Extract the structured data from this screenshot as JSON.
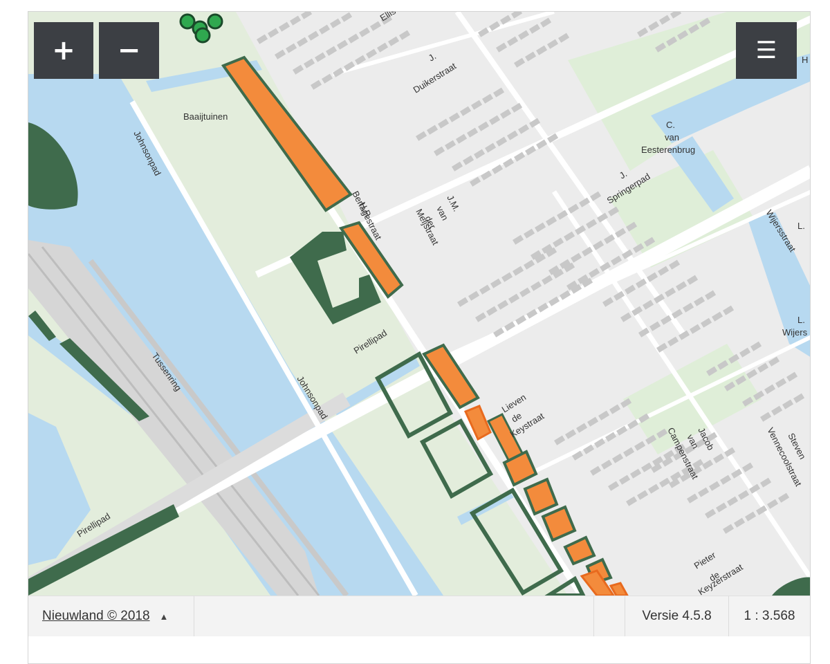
{
  "controls": {
    "zoom_in": "+",
    "zoom_out": "−",
    "menu": "☰"
  },
  "map_labels": {
    "baaijtuinen": "Baaijtuinen",
    "johnsonpad_1": "Johnsonpad",
    "johnsonpad_2": "Johnsonpad",
    "tussenring": "Tussenring",
    "pirellipad_1": "Pirellipad",
    "pirellipad_2": "Pirellipad",
    "hp_1": "H.P.",
    "berlagestraat": "Berlagestraat",
    "jm_1": "J.M.",
    "jm_2": "van",
    "jm_3": "der",
    "meijstraat": "Meijstraat",
    "j_duiker_1": "J.",
    "j_duiker_2": "Duikerstraat",
    "ellis": "Ellis",
    "c_van_1": "C.",
    "c_van_2": "van",
    "eesterenbrug": "Eesterenbrug",
    "j_springer_1": "J.",
    "j_springer_2": "Springerpad",
    "wijersstraat": "Wijersstraat",
    "l_1": "L.",
    "l_2": "L.",
    "wijers_2": "Wijers",
    "h": "H",
    "lieven_1": "Lieven",
    "lieven_2": "de",
    "lieven_3": "Keystraat",
    "jacob_1": "Jacob",
    "jacob_2": "van",
    "campenstraat": "Campenstraat",
    "steven_1": "Steven",
    "vennecoolstraat": "Vennecoolstraat",
    "pieter_1": "Pieter",
    "pieter_2": "de",
    "pieter_3": "Keyzerstraat"
  },
  "footer": {
    "credit": "Nieuwland © 2018",
    "caret": "▲",
    "version": "Versie 4.5.8",
    "scale": "1 : 3.568"
  },
  "colors": {
    "water": "#b7d9f0",
    "park": "#e3eddc",
    "forest": "#3f6b4c",
    "parcel": "#f38b3c",
    "parcel_outline": "#e86a1e",
    "building": "#c8c8c8",
    "road": "#ffffff",
    "control": "#3c3f44"
  }
}
